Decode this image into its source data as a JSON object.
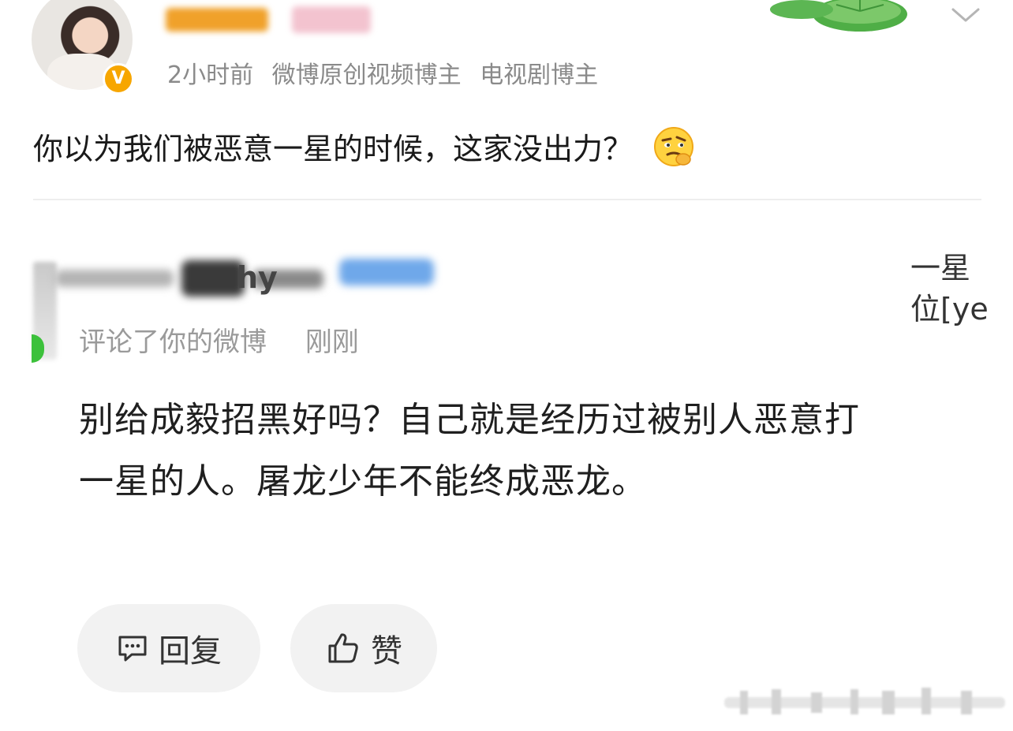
{
  "post": {
    "meta": {
      "time": "2小时前",
      "tag1": "微博原创视频博主",
      "tag2": "电视剧博主"
    },
    "verified_badge": "V",
    "text": "你以为我们被恶意一星的时候，这家没出力？",
    "emoji": "thinking-face-emoji",
    "icons": {
      "menu": "chevron-down-icon"
    }
  },
  "notification": {
    "commenter_fragment": "hy",
    "action": "评论了你的微博",
    "time": "刚刚",
    "comment": "别给成毅招黑好吗？自己就是经历过被别人恶意打一星的人。屠龙少年不能终成恶龙。",
    "side_preview": [
      "一星",
      "位[ye"
    ],
    "reply_label": "回复",
    "like_label": "赞",
    "icons": {
      "reply": "comment-icon",
      "like": "thumbs-up-icon"
    }
  },
  "colors": {
    "accent_badge": "#f7a600",
    "meta_gray": "#8a8a8a",
    "pill_bg": "#f2f2f2",
    "online_green": "#3cc13b"
  }
}
